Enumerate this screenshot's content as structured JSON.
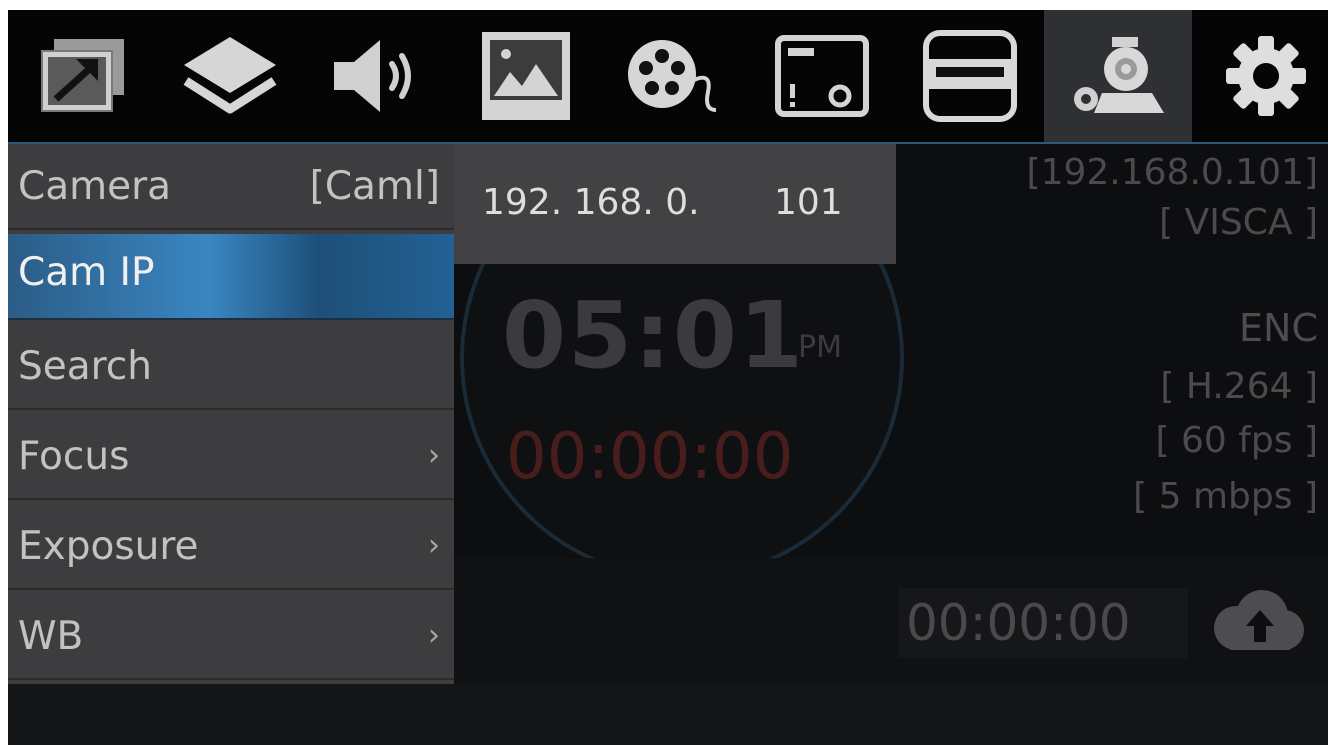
{
  "toolbar": {
    "buttons": [
      {
        "icon": "external-output-icon"
      },
      {
        "icon": "layers-icon"
      },
      {
        "icon": "speaker-icon"
      },
      {
        "icon": "image-icon"
      },
      {
        "icon": "film-reel-icon"
      },
      {
        "icon": "overlay-window-icon"
      },
      {
        "icon": "hdmi-icon"
      },
      {
        "icon": "camera-settings-icon",
        "active": true
      },
      {
        "icon": "gear-icon"
      }
    ]
  },
  "menu": {
    "items": [
      {
        "label": "Camera",
        "value": "[Caml]"
      },
      {
        "label": "Cam IP",
        "selected": true
      },
      {
        "label": "Search"
      },
      {
        "label": "Focus",
        "chevron": "›"
      },
      {
        "label": "Exposure",
        "chevron": "›"
      },
      {
        "label": "WB",
        "chevron": "›"
      }
    ]
  },
  "ip_editor": {
    "prefix": "192. 168. 0.",
    "octet": "101"
  },
  "status": {
    "ip": "[192.168.0.101]",
    "protocol": "[ VISCA ]",
    "enc_label": "ENC",
    "codec": "[ H.264 ]",
    "fps": "[ 60 fps ]",
    "bitrate": "[ 5 mbps ]"
  },
  "clock": {
    "time": "05:01",
    "ampm": "PM",
    "record_timer": "00:00:00"
  },
  "stream": {
    "timer": "00:00:00",
    "upload_icon": "cloud-upload-icon"
  },
  "colors": {
    "accent": "#3a86c2",
    "background": "#0d0e0f",
    "menu": "#3d3d3f",
    "record_red": "#4a1d1d"
  }
}
